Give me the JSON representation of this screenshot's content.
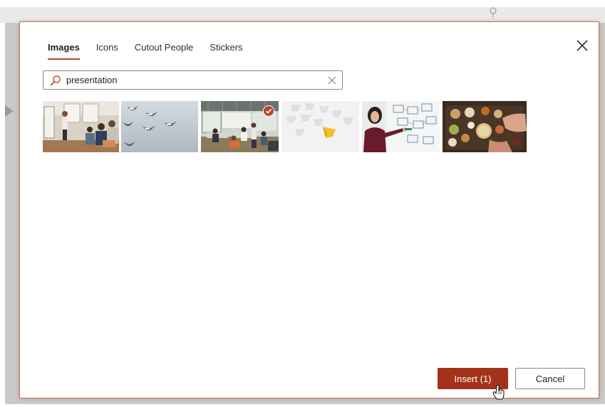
{
  "dialog": {
    "tabs": [
      {
        "label": "Images",
        "active": true
      },
      {
        "label": "Icons",
        "active": false
      },
      {
        "label": "Cutout People",
        "active": false
      },
      {
        "label": "Stickers",
        "active": false
      }
    ],
    "search": {
      "value": "presentation",
      "placeholder": ""
    },
    "results": [
      {
        "subject": "presenter-at-flipchart",
        "selected": false
      },
      {
        "subject": "birds-flying",
        "selected": false
      },
      {
        "subject": "open-office",
        "selected": true
      },
      {
        "subject": "paper-boats",
        "selected": false
      },
      {
        "subject": "woman-at-whiteboard",
        "selected": false
      },
      {
        "subject": "food-platter",
        "selected": false
      }
    ],
    "buttons": {
      "insert": "Insert (1)",
      "cancel": "Cancel"
    },
    "colors": {
      "accent": "#b7472a",
      "insert_bg": "#a4321b",
      "dialog_border": "#d2664a"
    },
    "icons": {
      "close": "close-icon",
      "search": "search-icon",
      "clear": "clear-icon",
      "selected": "check-circle-icon"
    }
  }
}
